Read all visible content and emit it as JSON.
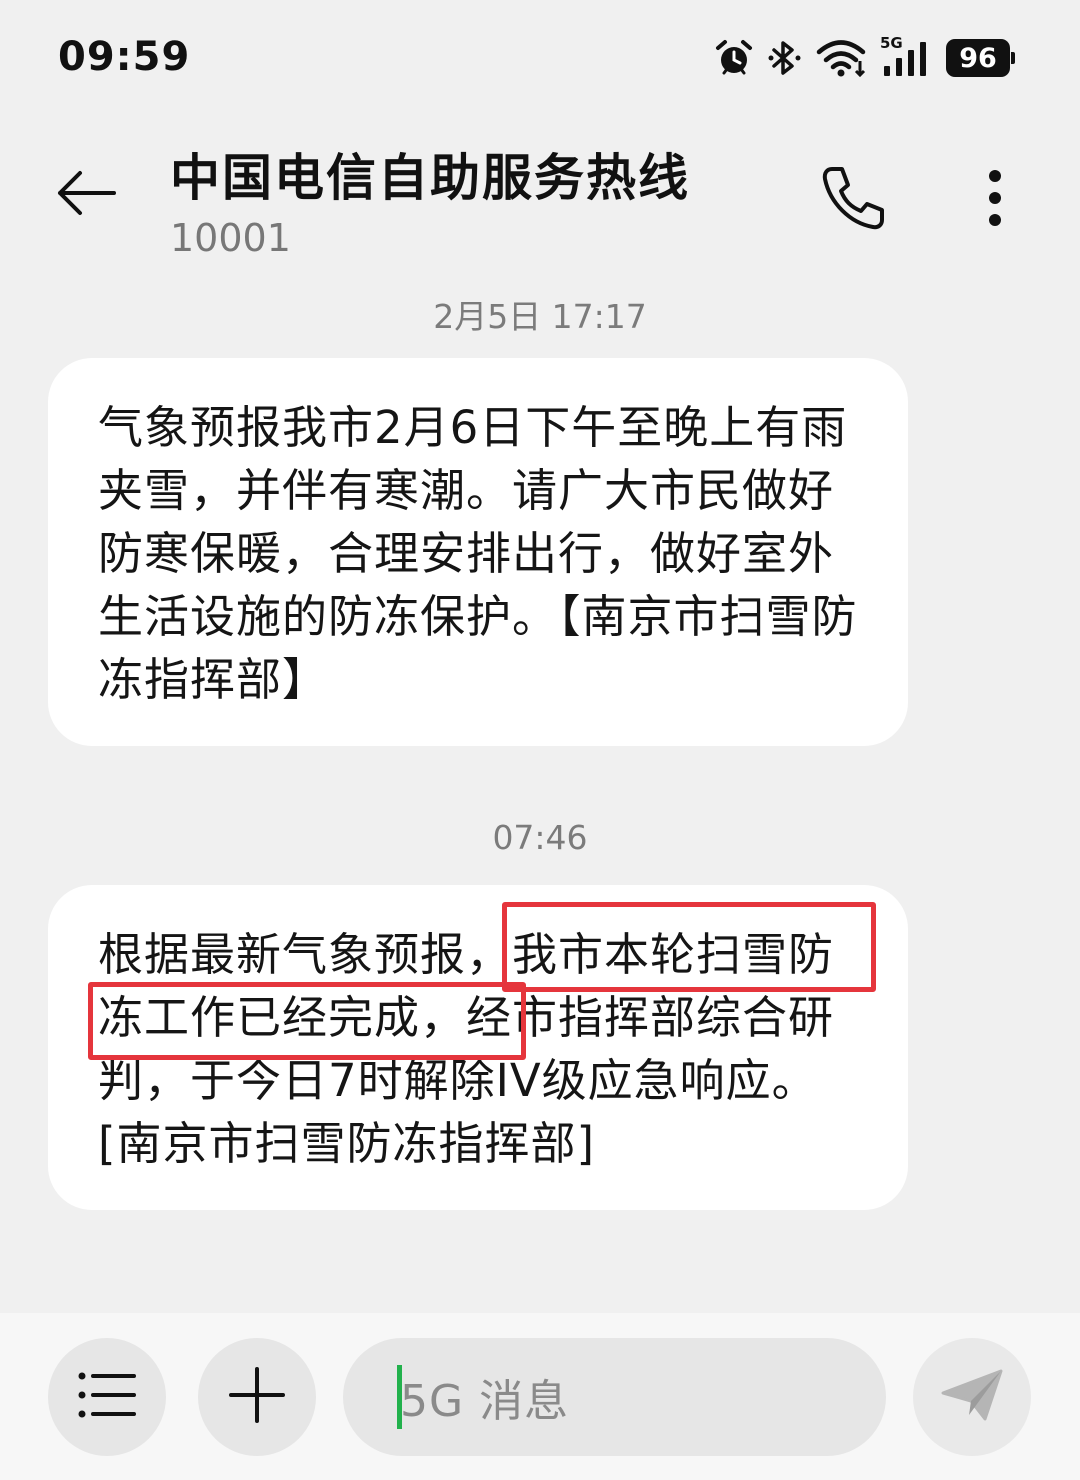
{
  "status_bar": {
    "time": "09:59",
    "network": "5G",
    "battery": "96",
    "icons": [
      "alarm-icon",
      "bluetooth-icon",
      "wifi-icon",
      "cellular-signal-icon",
      "battery-icon"
    ]
  },
  "header": {
    "contact_name": "中国电信自助服务热线",
    "contact_number": "10001",
    "icons": [
      "back-arrow-icon",
      "phone-icon",
      "more-vertical-icon"
    ]
  },
  "messages": [
    {
      "timestamp": "2月5日 17:17",
      "text": "气象预报我市2月6日下午至晚上有雨夹雪，并伴有寒潮。请广大市民做好防寒保暖，合理安排出行，做好室外生活设施的防冻保护。【南京市扫雪防冻指挥部】"
    },
    {
      "timestamp": "07:46",
      "text": "根据最新气象预报，我市本轮扫雪防冻工作已经完成，经市指挥部综合研判，于今日7时解除IV级应急响应。[南京市扫雪防冻指挥部]"
    }
  ],
  "annotation_color": "#e5353c",
  "input_bar": {
    "placeholder": "5G 消息",
    "icons": [
      "menu-icon",
      "plus-icon",
      "send-icon"
    ]
  }
}
